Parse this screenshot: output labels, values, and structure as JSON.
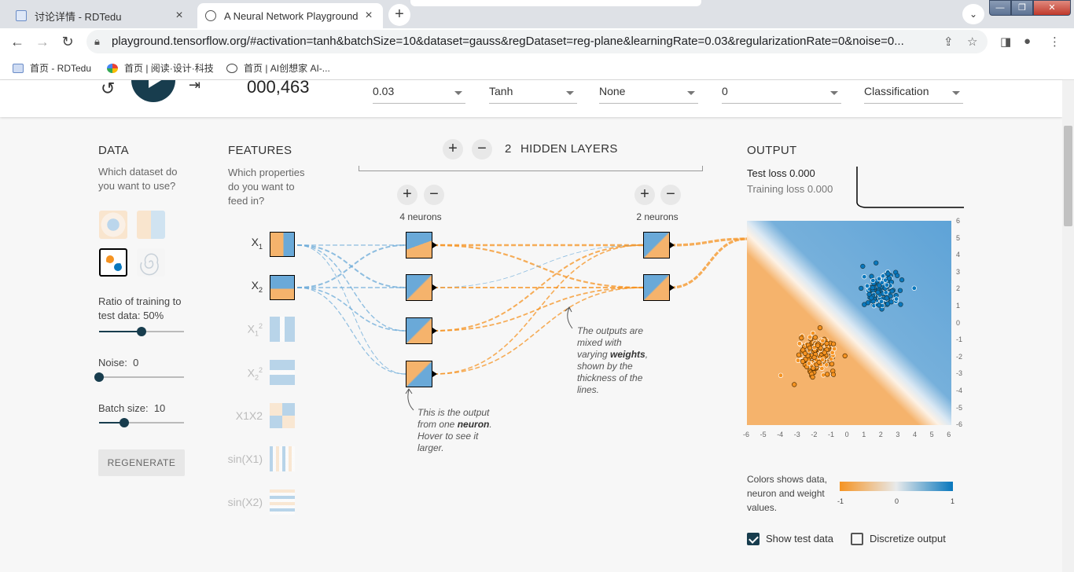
{
  "browser": {
    "tabs": [
      {
        "title": "讨论详情 - RDTedu"
      },
      {
        "title": "A Neural Network Playground"
      }
    ],
    "url": "playground.tensorflow.org/#activation=tanh&batchSize=10&dataset=gauss&regDataset=reg-plane&learningRate=0.03&regularizationRate=0&noise=0...",
    "bookmarks": [
      "首页 - RDTedu",
      "首页 | 阅读·设计·科技",
      "首页 | AI创想家 AI-..."
    ]
  },
  "controls": {
    "epoch": "000,463",
    "learning_rate": "0.03",
    "activation": "Tanh",
    "regularization": "None",
    "regularization_rate": "0",
    "problem_type": "Classification"
  },
  "data_panel": {
    "title": "DATA",
    "subtitle": "Which dataset do you want to use?",
    "ratio_label": "Ratio of training to test data:",
    "ratio_value": "50%",
    "ratio_fraction": 0.5,
    "noise_label": "Noise:",
    "noise_value": "0",
    "noise_fraction": 0,
    "batch_label": "Batch size:",
    "batch_value": "10",
    "batch_fraction": 0.3,
    "regenerate_label": "REGENERATE"
  },
  "features_panel": {
    "title": "FEATURES",
    "subtitle": "Which properties do you want to feed in?",
    "features": [
      {
        "base": "X",
        "sub": "1",
        "sup": "",
        "active": true
      },
      {
        "base": "X",
        "sub": "2",
        "sup": "",
        "active": true
      },
      {
        "base": "X",
        "sub": "1",
        "sup": "2",
        "active": false
      },
      {
        "base": "X",
        "sub": "2",
        "sup": "2",
        "active": false
      },
      {
        "base": "X1X2",
        "sub": "",
        "sup": "",
        "active": false
      },
      {
        "base": "sin(X1)",
        "sub": "",
        "sup": "",
        "active": false
      },
      {
        "base": "sin(X2)",
        "sub": "",
        "sup": "",
        "active": false
      }
    ]
  },
  "network": {
    "hidden_layers_count": "2",
    "hidden_layers_label": "HIDDEN LAYERS",
    "layer1_label": "4 neurons",
    "layer2_label": "2 neurons",
    "hint_neuron": "This is the output from one neuron. Hover to see it larger.",
    "hint_weights": "The outputs are mixed with varying weights, shown by the thickness of the lines."
  },
  "output": {
    "title": "OUTPUT",
    "test_loss": "Test loss 0.000",
    "training_loss": "Training loss 0.000",
    "y_ticks": [
      "6",
      "5",
      "4",
      "3",
      "2",
      "1",
      "0",
      "-1",
      "-2",
      "-3",
      "-4",
      "-5",
      "-6"
    ],
    "x_ticks": [
      "-6",
      "-5",
      "-4",
      "-3",
      "-2",
      "-1",
      "0",
      "1",
      "2",
      "3",
      "4",
      "5",
      "6"
    ],
    "legend_text": "Colors shows data, neuron and weight values.",
    "legend_ticks": [
      "-1",
      "0",
      "1"
    ],
    "show_test_data": "Show test data",
    "discretize_output": "Discretize output"
  },
  "colors": {
    "orange": "#f59322",
    "blue": "#0877bd",
    "dark": "#183d4e"
  }
}
